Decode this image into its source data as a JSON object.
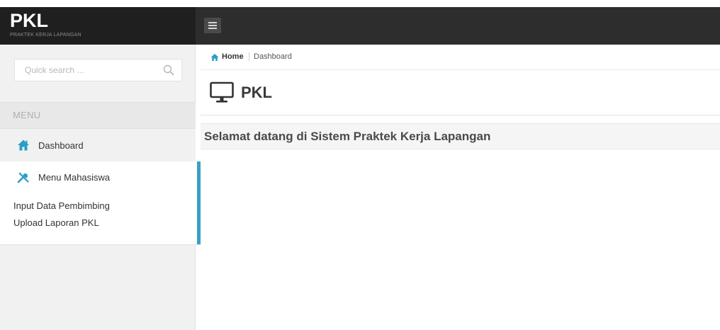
{
  "brand": {
    "title": "PKL",
    "subtitle": "PRAKTEK KERJA LAPANGAN"
  },
  "search": {
    "placeholder": "Quick search ..."
  },
  "sidebar": {
    "menu_header": "MENU",
    "items": [
      {
        "label": "Dashboard",
        "icon": "home-icon"
      },
      {
        "label": "Menu Mahasiswa",
        "icon": "tools-icon"
      }
    ],
    "sub_items": [
      {
        "label": "Input Data Pembimbing"
      },
      {
        "label": "Upload Laporan PKL"
      }
    ]
  },
  "breadcrumb": {
    "home": "Home",
    "current": "Dashboard"
  },
  "main": {
    "title": "PKL",
    "welcome": "Selamat datang di Sistem Praktek Kerja Lapangan"
  },
  "colors": {
    "header_bg": "#2d2d2d",
    "brand_bg": "#1f1f1f",
    "accent": "#3aa1c4",
    "icon_teal": "#2a9ec7"
  }
}
